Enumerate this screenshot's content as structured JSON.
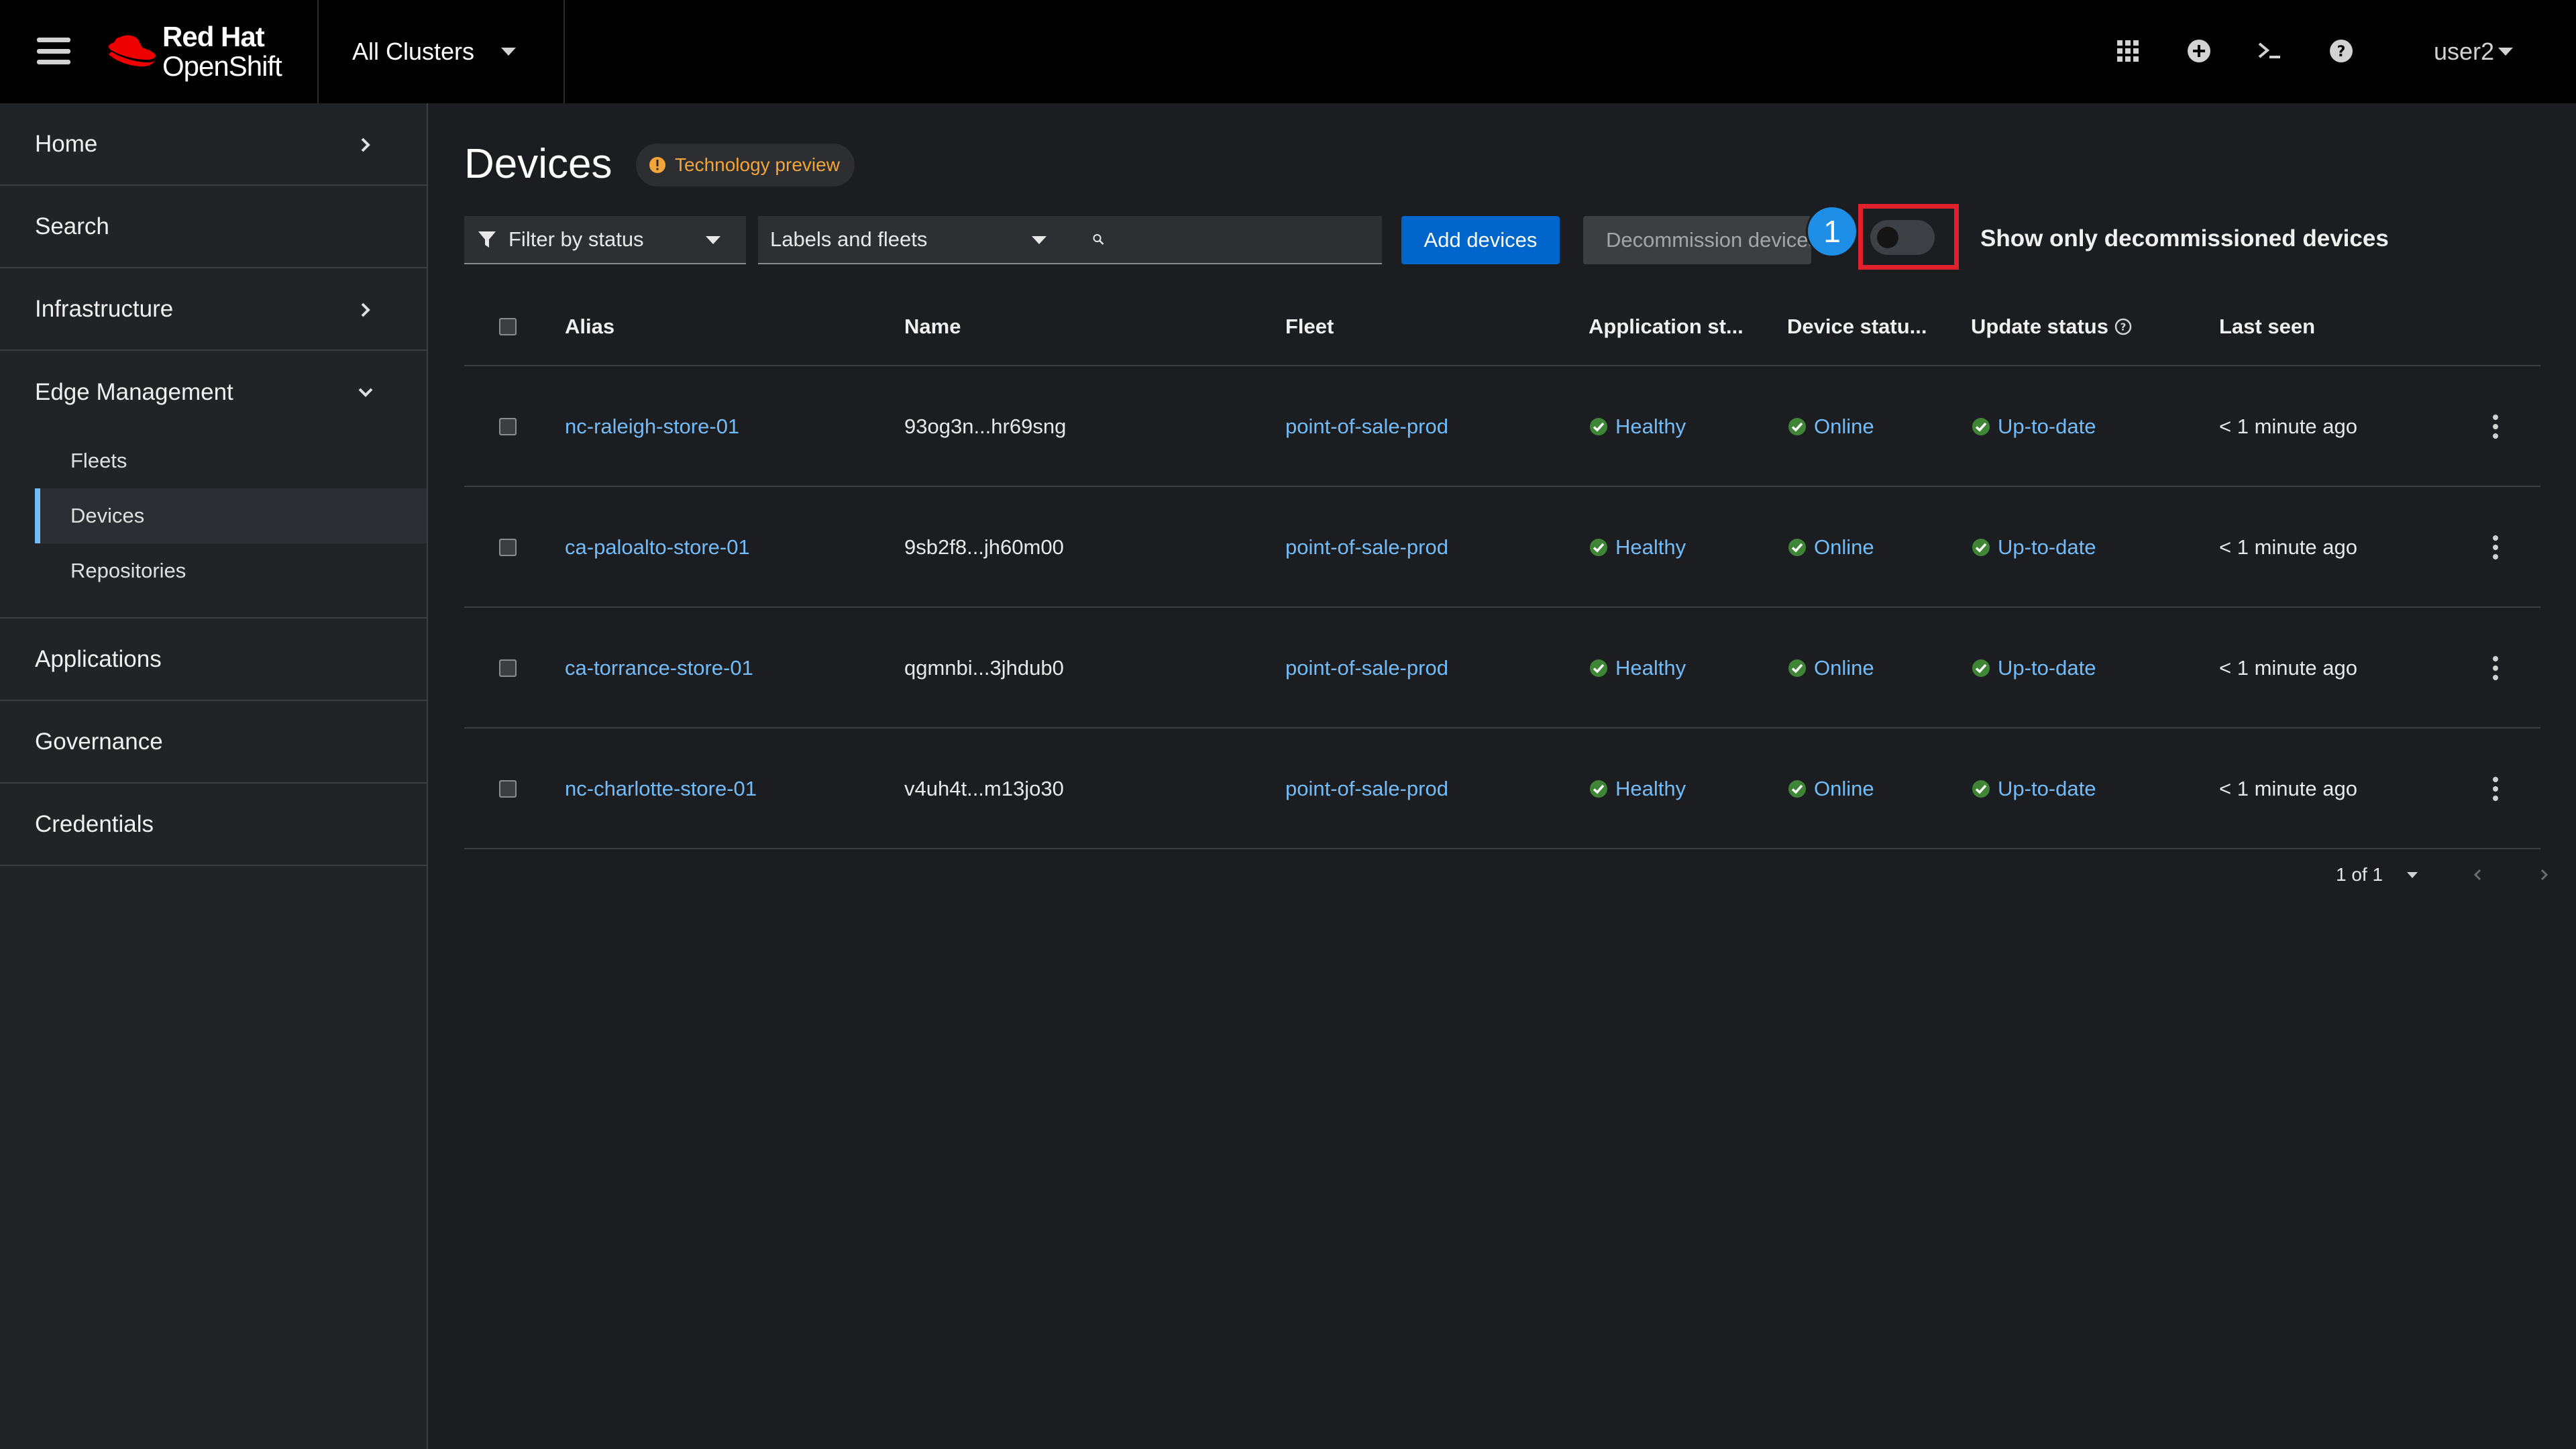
{
  "masthead": {
    "brand_line1": "Red Hat",
    "brand_line2": "OpenShift",
    "cluster_selector": "All Clusters",
    "icons": [
      "apps-grid-icon",
      "plus-circle-icon",
      "terminal-icon",
      "help-icon"
    ],
    "user": "user2"
  },
  "sidebar": {
    "items": [
      {
        "label": "Home"
      },
      {
        "label": "Search"
      },
      {
        "label": "Infrastructure"
      },
      {
        "label": "Edge Management",
        "expanded": true
      },
      {
        "label": "Applications"
      },
      {
        "label": "Governance"
      },
      {
        "label": "Credentials"
      }
    ],
    "edge_children": [
      {
        "label": "Fleets"
      },
      {
        "label": "Devices",
        "active": true
      },
      {
        "label": "Repositories"
      }
    ]
  },
  "page": {
    "title": "Devices",
    "badge": "Technology preview"
  },
  "toolbar": {
    "filter_status": "Filter by status",
    "labels_fleets": "Labels and fleets",
    "search_value": "",
    "add_devices": "Add devices",
    "decommission": "Decommission devices",
    "step_number": "1",
    "toggle_label": "Show only decommissioned devices",
    "toggle_on": false
  },
  "table": {
    "columns": [
      "Alias",
      "Name",
      "Fleet",
      "Application st...",
      "Device statu...",
      "Update status",
      "Last seen"
    ],
    "rows": [
      {
        "alias": "nc-raleigh-store-01",
        "name": "93og3n...hr69sng",
        "fleet": "point-of-sale-prod",
        "app_status": "Healthy",
        "device_status": "Online",
        "update_status": "Up-to-date",
        "last_seen": "< 1 minute ago"
      },
      {
        "alias": "ca-paloalto-store-01",
        "name": "9sb2f8...jh60m00",
        "fleet": "point-of-sale-prod",
        "app_status": "Healthy",
        "device_status": "Online",
        "update_status": "Up-to-date",
        "last_seen": "< 1 minute ago"
      },
      {
        "alias": "ca-torrance-store-01",
        "name": "qgmnbi...3jhdub0",
        "fleet": "point-of-sale-prod",
        "app_status": "Healthy",
        "device_status": "Online",
        "update_status": "Up-to-date",
        "last_seen": "< 1 minute ago"
      },
      {
        "alias": "nc-charlotte-store-01",
        "name": "v4uh4t...m13jo30",
        "fleet": "point-of-sale-prod",
        "app_status": "Healthy",
        "device_status": "Online",
        "update_status": "Up-to-date",
        "last_seen": "< 1 minute ago"
      }
    ]
  },
  "pagination": {
    "range": "1 of 1"
  },
  "colors": {
    "accent_link": "#73bcf7",
    "primary_button": "#0066cc",
    "success": "#3e8635",
    "highlight": "#e0212c",
    "badge_orange": "#f4a53a"
  }
}
